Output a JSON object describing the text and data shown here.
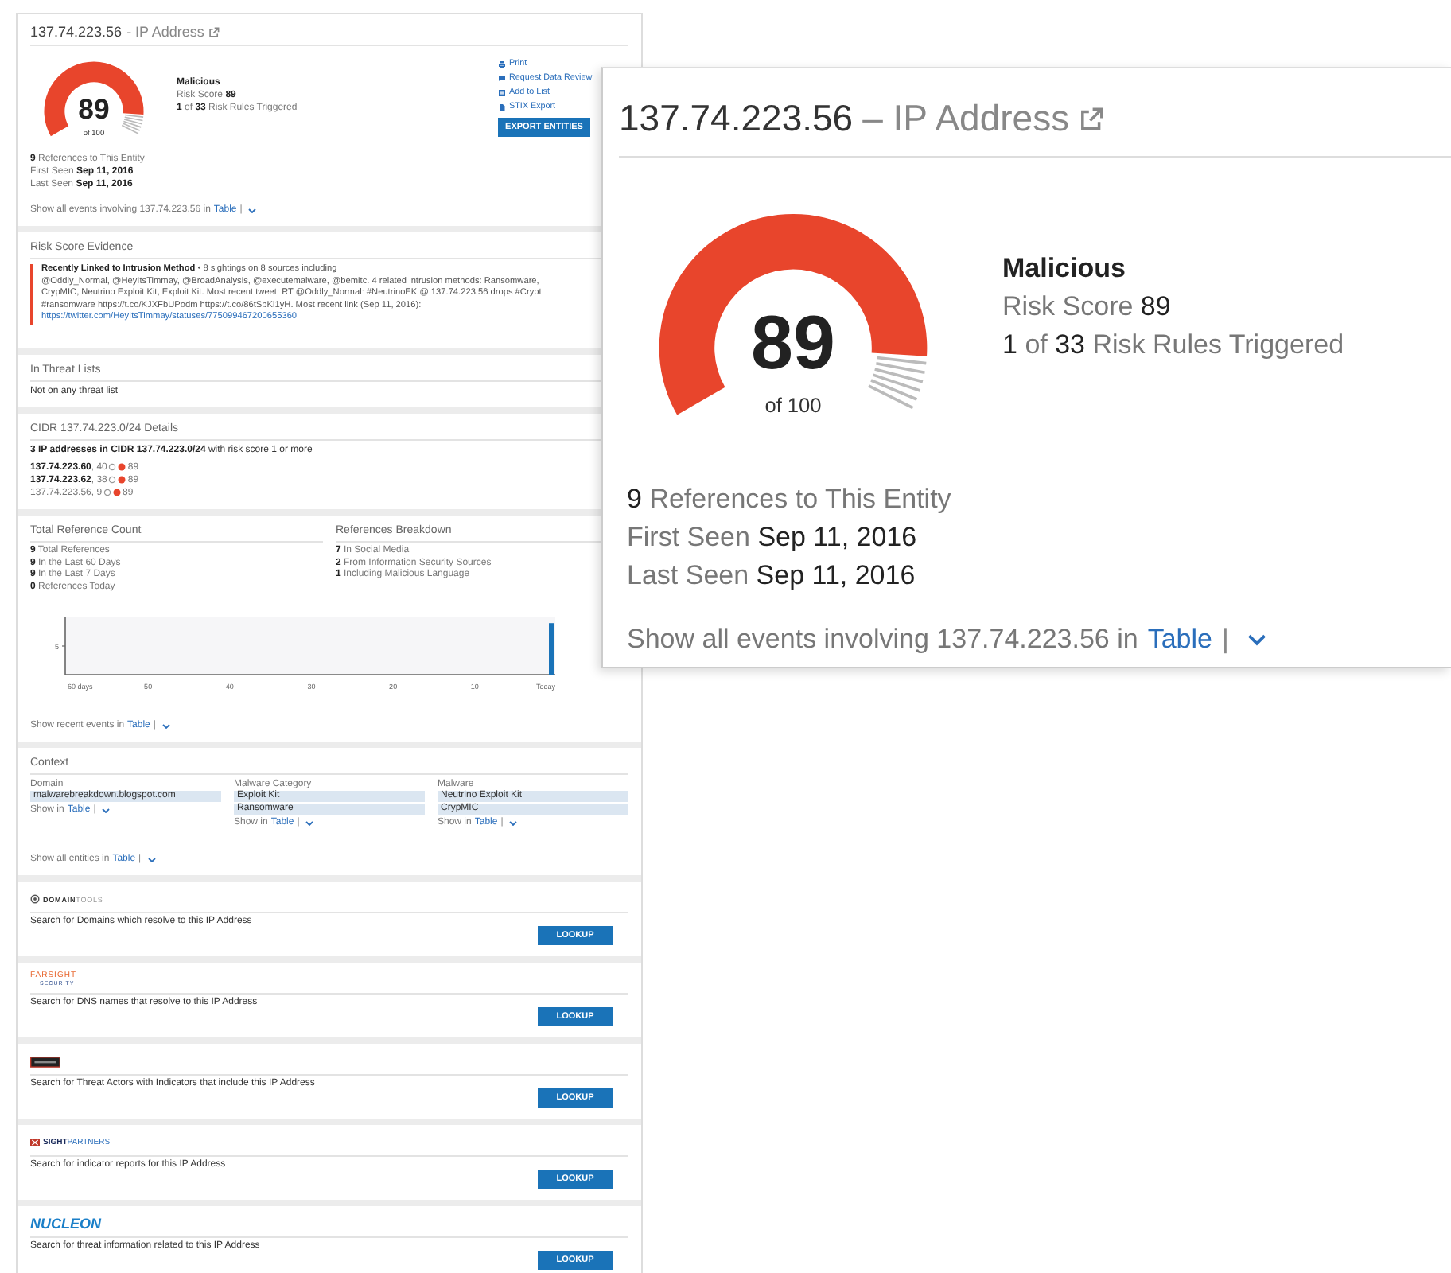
{
  "header": {
    "ip": "137.74.223.56",
    "type_label": "- IP Address",
    "score": "89",
    "score_max": "of 100",
    "level": 0.89,
    "verdict": "Malicious",
    "lines": [
      "Risk Score **89**",
      "**1** of **33** Risk Rules Triggered"
    ],
    "actions": [
      {
        "kind": "print",
        "label": "Print"
      },
      {
        "kind": "flag",
        "label": "Request Data Review"
      },
      {
        "kind": "list",
        "label": "Add to List"
      },
      {
        "kind": "file",
        "label": "STIX Export"
      }
    ],
    "export_button": "EXPORT ENTITIES",
    "facts": [
      "**9** References to This Entity",
      "First Seen **Sep 11, 2016**",
      "Last Seen **Sep 11, 2016**"
    ],
    "show": {
      "text": "Show all events involving 137.74.223.56 in",
      "link": "Table",
      "sep": "|"
    }
  },
  "evidence": {
    "title": "Risk Score Evidence",
    "text": "**Recently Linked to Intrusion Method** • 8 sightings on 8 sources including\n@Oddly_Normal, @HeyItsTimmay, @BroadAnalysis, @executemalware, @bemitc. 4 related intrusion methods: Ransomware,\nCrypMIC, Neutrino Exploit Kit, Exploit Kit. Most recent tweet: RT @Oddly_Normal: #NeutrinoEK @ 137.74.223.56 drops #Crypt\n#ransomware https://t.co/KJXFbUPodm https://t.co/86tSpKl1yH. Most recent link (Sep 11, 2016):",
    "link": "https://twitter.com/HeyItsTimmay/statuses/775099467200655360"
  },
  "threat_lists": {
    "title": "In Threat Lists",
    "text": "Not on any threat list"
  },
  "cidr": {
    "title": "CIDR 137.74.223.0/24 Details",
    "summary": "**3 IP addresses in CIDR 137.74.223.0/24** with risk score 1 or more",
    "rows": [
      {
        "label": "**137.74.223.60**, 40",
        "score": "89"
      },
      {
        "label": "**137.74.223.62**, 38",
        "score": "89"
      },
      {
        "label": "137.74.223.56, 9",
        "score": "89"
      }
    ]
  },
  "references": {
    "total_title": "Total Reference Count",
    "totals": [
      "**9** Total References",
      "**9** In the Last 60 Days",
      "**9** In the Last 7 Days",
      "**0** References Today"
    ],
    "breakdown_title": "References Breakdown",
    "breakdown": [
      "**7** In Social Media",
      "**2** From Information Security Sources",
      "**1** Including Malicious Language"
    ],
    "chart_data": {
      "type": "bar",
      "x": [
        0
      ],
      "values": [
        9
      ],
      "xlim": [
        -60,
        0
      ],
      "ylim": [
        0,
        10
      ],
      "xticks": [
        {
          "value": -60,
          "label": "-60 days"
        },
        {
          "value": -50,
          "label": "-50"
        },
        {
          "value": -40,
          "label": "-40"
        },
        {
          "value": -30,
          "label": "-30"
        },
        {
          "value": -20,
          "label": "-20"
        },
        {
          "value": -10,
          "label": "-10"
        },
        {
          "value": 0,
          "label": "Today"
        }
      ],
      "yticks": [
        5
      ]
    },
    "show": {
      "text": "Show recent events in",
      "link": "Table",
      "sep": "|"
    }
  },
  "context": {
    "title": "Context",
    "columns": [
      {
        "heading": "Domain",
        "tags": [
          "malwarebreakdown.blogspot.com"
        ],
        "show": "Show in",
        "link": "Table",
        "sep": "|"
      },
      {
        "heading": "Malware Category",
        "tags": [
          "Exploit Kit",
          "Ransomware"
        ],
        "show": "Show in",
        "link": "Table",
        "sep": "|"
      },
      {
        "heading": "Malware",
        "tags": [
          "Neutrino Exploit Kit",
          "CrypMIC"
        ],
        "show": "Show in",
        "link": "Table",
        "sep": "|"
      }
    ],
    "show": {
      "text": "Show all entities in",
      "link": "Table",
      "sep": "|"
    }
  },
  "lookups": [
    {
      "kind": "domaintools",
      "logo": "**DOMAIN**TOOLS",
      "text": "Search for Domains which resolve to this IP Address",
      "button": "LOOKUP"
    },
    {
      "kind": "farsight",
      "logo": "FARSIGHT",
      "logo_sub": "SECURITY",
      "text": "Search for DNS names that resolve to this IP Address",
      "button": "LOOKUP"
    },
    {
      "kind": "badge",
      "text": "Search for Threat Actors with Indicators that include this IP Address",
      "button": "LOOKUP"
    },
    {
      "kind": "isight",
      "logo": "**SIGHT**PARTNERS",
      "text": "Search for indicator reports for this IP Address",
      "button": "LOOKUP"
    },
    {
      "kind": "nucleon",
      "logo": "NUCLEON",
      "text": "Search for threat information related to this IP Address",
      "button": "LOOKUP"
    }
  ],
  "callout": {
    "ip": "137.74.223.56",
    "type_label": "– IP Address",
    "score": "89",
    "score_max": "of 100",
    "verdict": "Malicious",
    "lines": [
      "Risk Score **89**",
      "**1** of **33** Risk Rules Triggered"
    ],
    "facts": [
      "**9** References to This Entity",
      "First Seen **Sep 11, 2016**",
      "Last Seen **Sep 11, 2016**"
    ],
    "show": {
      "text": "Show all events involving 137.74.223.56 in",
      "link": "Table",
      "sep": "|"
    }
  }
}
